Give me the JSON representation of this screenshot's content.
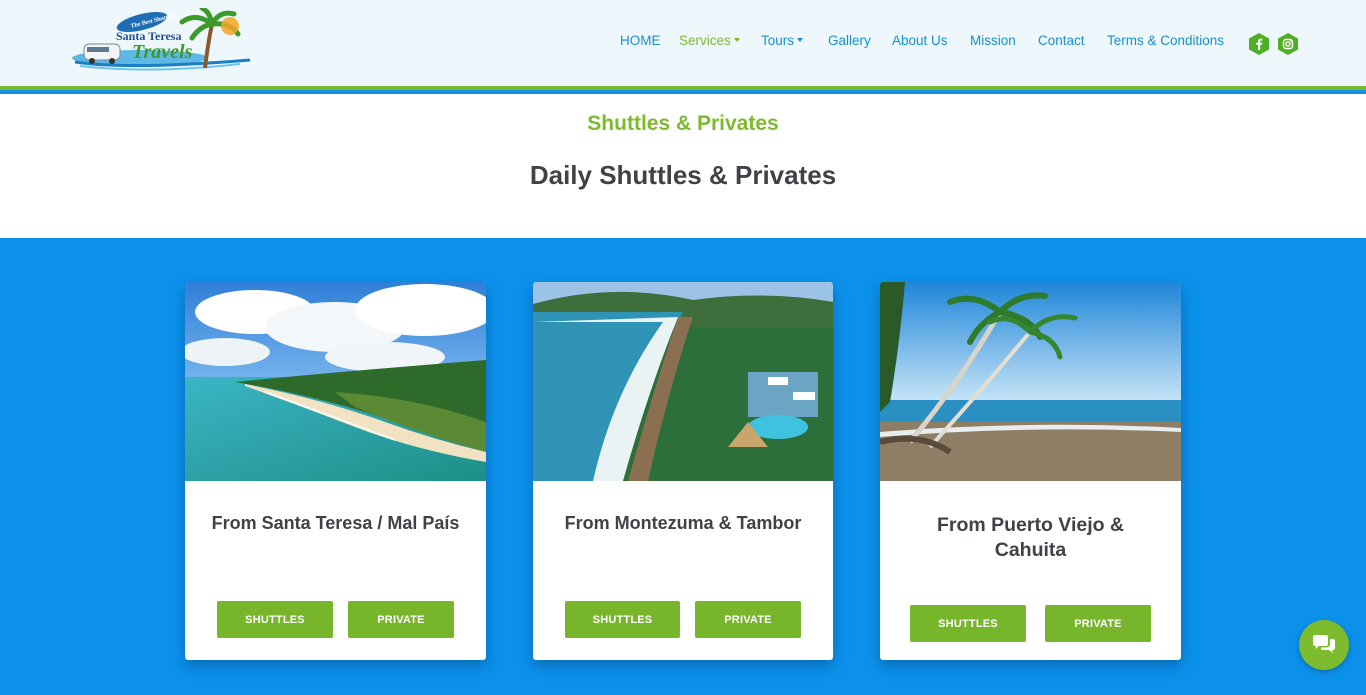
{
  "brand": {
    "logo_line1": "Santa Teresa",
    "logo_line2": "Travels",
    "logo_badge": "The Best Shuttles"
  },
  "nav": {
    "items": [
      {
        "label": "HOME"
      },
      {
        "label": "Services",
        "dropdown": true,
        "active": true
      },
      {
        "label": "Tours",
        "dropdown": true
      },
      {
        "label": "Gallery"
      },
      {
        "label": "About Us"
      },
      {
        "label": "Mission"
      },
      {
        "label": "Contact"
      },
      {
        "label": "Terms & Conditions"
      }
    ],
    "social": [
      "facebook-icon",
      "instagram-icon"
    ]
  },
  "section": {
    "subtitle": "Shuttles & Privates",
    "title": "Daily Shuttles & Privates"
  },
  "cards": [
    {
      "title": "From Santa Teresa / Mal País",
      "shuttles_label": "SHUTTLES",
      "private_label": "PRIVATE",
      "image": "coastline-aerial"
    },
    {
      "title": "From Montezuma & Tambor",
      "shuttles_label": "SHUTTLES",
      "private_label": "PRIVATE",
      "image": "beach-resort-aerial"
    },
    {
      "title": "From Puerto Viejo & Cahuita",
      "shuttles_label": "SHUTTLES",
      "private_label": "PRIVATE",
      "image": "palm-beach"
    }
  ],
  "colors": {
    "accent_green": "#7dbb2e",
    "nav_blue": "#1a8fd0",
    "band_blue": "#0b91ec",
    "button_green": "#77b52a",
    "heading_dark": "#3f4347"
  },
  "chat_icon": "chat-bubbles-icon"
}
